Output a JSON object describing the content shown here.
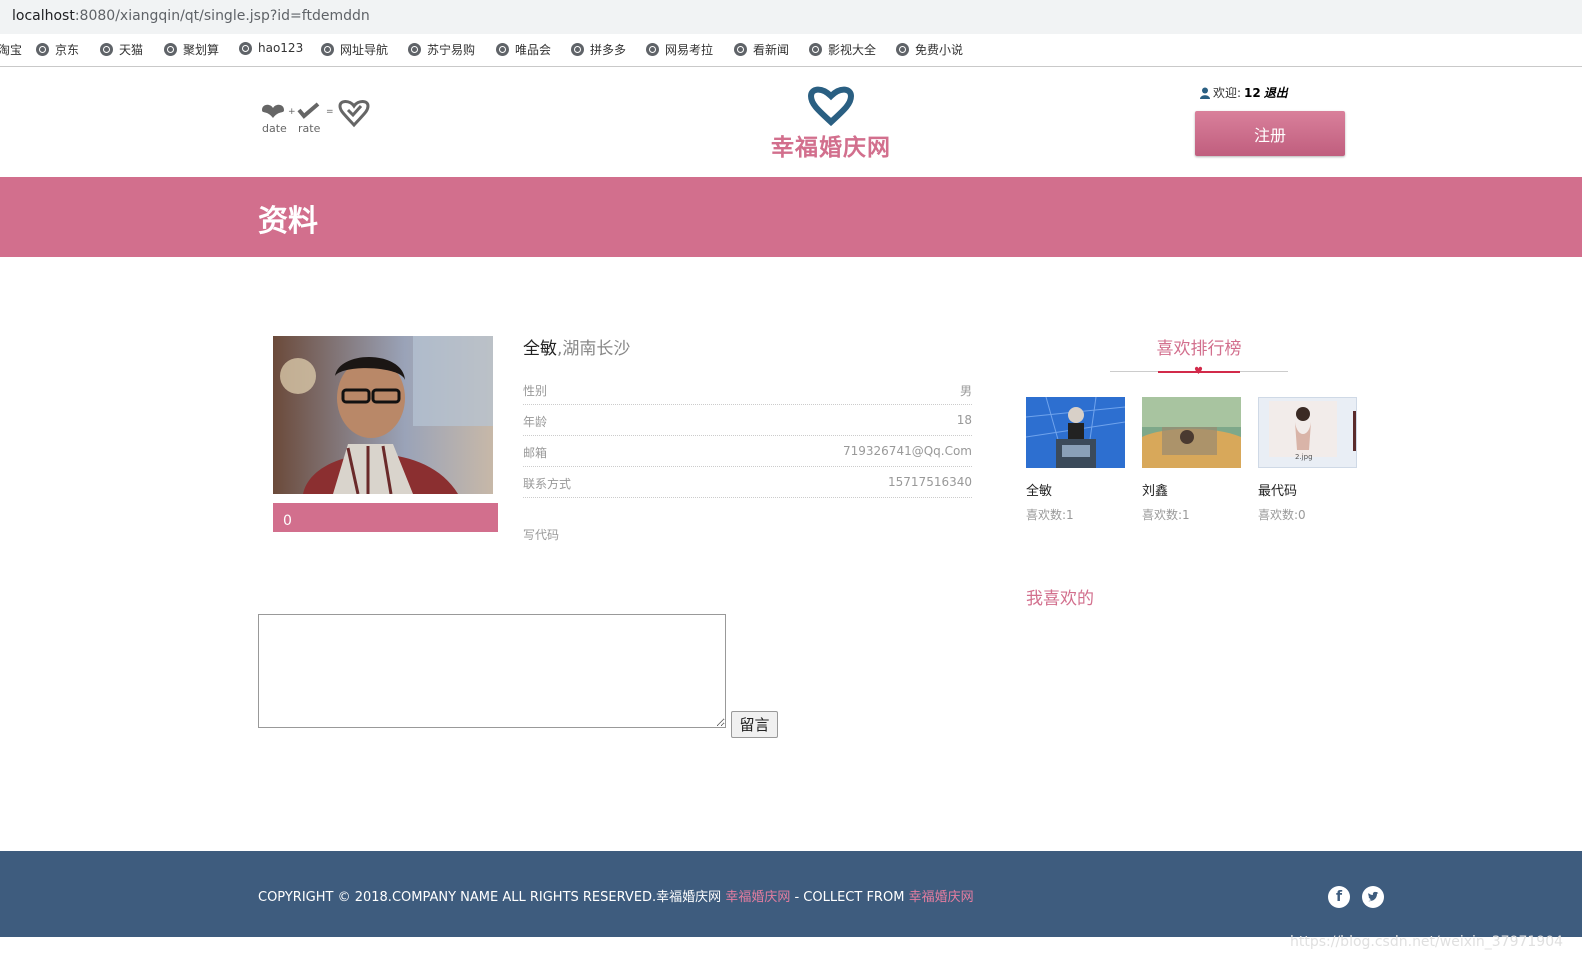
{
  "browser": {
    "url_host": "localhost",
    "url_rest": ":8080/xiangqin/qt/single.jsp?id=ftdemddn",
    "bookmarks": [
      "淘宝",
      "京东",
      "天猫",
      "聚划算",
      "hao123",
      "网址导航",
      "苏宁易购",
      "唯品会",
      "拼多多",
      "网易考拉",
      "看新闻",
      "影视大全",
      "免费小说"
    ]
  },
  "header": {
    "logo_left_date": "date",
    "logo_left_rate": "rate",
    "site_title": "幸福婚庆网",
    "welcome_prefix": "欢迎:",
    "username": "12",
    "logout": "退出",
    "register_label": "注册"
  },
  "banner": {
    "title": "资料"
  },
  "profile": {
    "name": "全敏",
    "location": ",湖南长沙",
    "like_count": "0",
    "fields": [
      {
        "label": "性别",
        "value": "男"
      },
      {
        "label": "年龄",
        "value": "18"
      },
      {
        "label": "邮箱",
        "value": "719326741@Qq.Com"
      },
      {
        "label": "联系方式",
        "value": "15717516340"
      }
    ],
    "motto": "写代码"
  },
  "ranking": {
    "title": "喜欢排行榜",
    "cards": [
      {
        "name": "全敏",
        "likes": "喜欢数:1"
      },
      {
        "name": "刘鑫",
        "likes": "喜欢数:1"
      },
      {
        "name": "最代码",
        "likes": "喜欢数:0",
        "img_caption": "2.jpg"
      }
    ]
  },
  "my_likes": {
    "title": "我喜欢的"
  },
  "comment": {
    "button_label": "留言"
  },
  "footer": {
    "copyright_main": "COPYRIGHT © 2018.COMPANY NAME ALL RIGHTS RESERVED.幸福婚庆网 ",
    "copyright_link1": "幸福婚庆网",
    "copyright_mid": " - COLLECT FROM ",
    "copyright_link2": "幸福婚庆网",
    "social": [
      "facebook-icon",
      "twitter-icon"
    ]
  },
  "watermark": "https://blog.csdn.net/weixin_37971904",
  "colors": {
    "accent": "#d26f8d",
    "footer": "#3e5c7e",
    "logo_heart": "#2a5f82"
  }
}
